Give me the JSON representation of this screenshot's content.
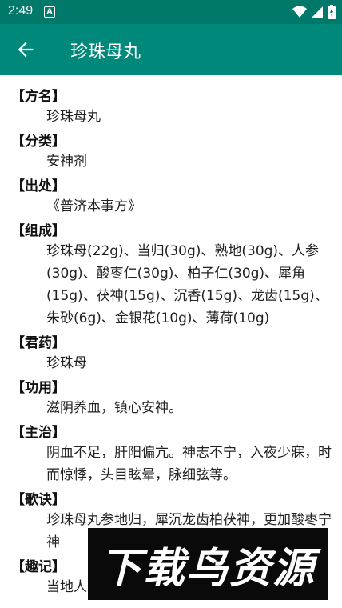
{
  "status": {
    "time": "2:49",
    "notif_icon": "A"
  },
  "appbar": {
    "title": "珍珠母丸",
    "back_icon": "arrow-left"
  },
  "sections": [
    {
      "label": "【方名】",
      "text": "珍珠母丸"
    },
    {
      "label": "【分类】",
      "text": "安神剂"
    },
    {
      "label": "【出处】",
      "text": "《普济本事方》"
    },
    {
      "label": "【组成】",
      "text": "珍珠母(22g)、当归(30g)、熟地(30g)、人参(30g)、酸枣仁(30g)、柏子仁(30g)、犀角(15g)、茯神(15g)、沉香(15g)、龙齿(15g)、朱砂(6g)、金银花(10g)、薄荷(10g)"
    },
    {
      "label": "【君药】",
      "text": "珍珠母"
    },
    {
      "label": "【功用】",
      "text": "滋阴养血，镇心安神。"
    },
    {
      "label": "【主治】",
      "text": "阴血不足，肝阳偏亢。神志不宁，入夜少寐，时而惊悸，头目眩晕，脉细弦等。"
    },
    {
      "label": "【歌诀】",
      "text": "珍珠母丸参地归，犀沉龙齿柏茯神，更加酸枣宁神"
    },
    {
      "label": "【趣记】",
      "text": "当地人"
    }
  ],
  "watermark": {
    "text": "下载鸟资源"
  },
  "colors": {
    "statusbar": "#00796b",
    "appbar": "#00897b"
  }
}
